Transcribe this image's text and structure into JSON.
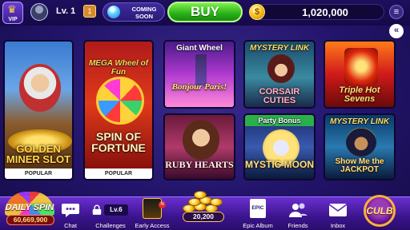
{
  "topbar": {
    "vip_label": "VIP",
    "level_label": "Lv. 1",
    "level_badge": "1",
    "coming_soon": "COMING SOON",
    "buy_label": "BUY",
    "coin_balance": "1,020,000",
    "coin_symbol": "$",
    "menu_glyph": "≡",
    "collapse_glyph": "«"
  },
  "games": [
    {
      "title_top": "",
      "title_bottom": "GOLDEN MINER SLOT",
      "tag": "POPULAR"
    },
    {
      "title_top": "MEGA Wheel of Fun",
      "title_bottom": "SPIN OF FORTUNE",
      "tag": "POPULAR"
    },
    {
      "title_top": "Giant Wheel",
      "title_bottom": "Bonjour Paris!",
      "tag": ""
    },
    {
      "title_top": "MYSTERY LINK",
      "title_bottom": "CORSAIR CUTIES",
      "tag": ""
    },
    {
      "title_top": "",
      "title_bottom": "Triple Hot Sevens",
      "tag": ""
    },
    {
      "title_top": "",
      "title_bottom": "RUBY HEARTS",
      "tag": ""
    },
    {
      "title_top": "Party Bonus",
      "title_bottom": "MYSTIC MOON",
      "tag": ""
    },
    {
      "title_top": "MYSTERY LINK",
      "title_bottom": "Show Me the JACKPOT",
      "tag": ""
    }
  ],
  "bottombar": {
    "daily_spin_label": "DAILY SPIN",
    "daily_spin_amount": "60,669,900",
    "chat_label": "Chat",
    "challenges_label": "Challenges",
    "challenges_badge": "Lv.6",
    "early_access_label": "Early Access",
    "pile_amount": "20,200",
    "epic_album_label": "Epic Album",
    "epic_badge": "EPIC",
    "friends_label": "Friends",
    "inbox_label": "Inbox",
    "club_label": "CULB"
  },
  "colors": {
    "background": "#22146a",
    "buy_green": "#29b019",
    "coin_gold": "#ffc21a",
    "tag_white": "#ffffff"
  }
}
